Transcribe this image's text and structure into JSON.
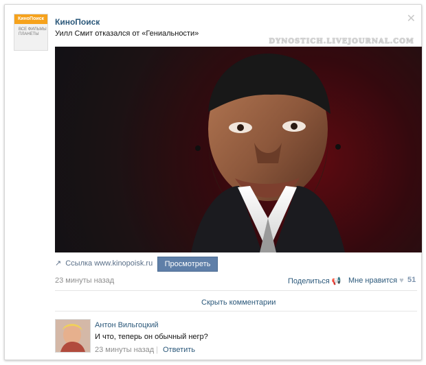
{
  "post": {
    "author": "КиноПоиск",
    "text": "Уилл Смит отказался от «Гениальности»",
    "watermark": "DYNOSTICH.LIVEJOURNAL.COM",
    "avatar_logo_top": "КиноПоиск",
    "avatar_logo_sub": "ВСЕ ФИЛЬМЫ ПЛАНЕТЫ",
    "link_label": "Ссылка www.kinopoisk.ru",
    "view_button": "Просмотреть",
    "time": "23 минуты назад",
    "share_label": "Поделиться",
    "like_label": "Мне нравится",
    "like_count": "51"
  },
  "comments": {
    "toggle_label": "Скрыть комментарии",
    "items": [
      {
        "author": "Антон Вильгоцкий",
        "text": "И что, теперь он обычный негр?",
        "time": "23 минуты назад",
        "reply": "Ответить"
      }
    ]
  },
  "colors": {
    "link": "#2b587a",
    "muted": "#8e8e8e",
    "button": "#5f7fa8"
  }
}
